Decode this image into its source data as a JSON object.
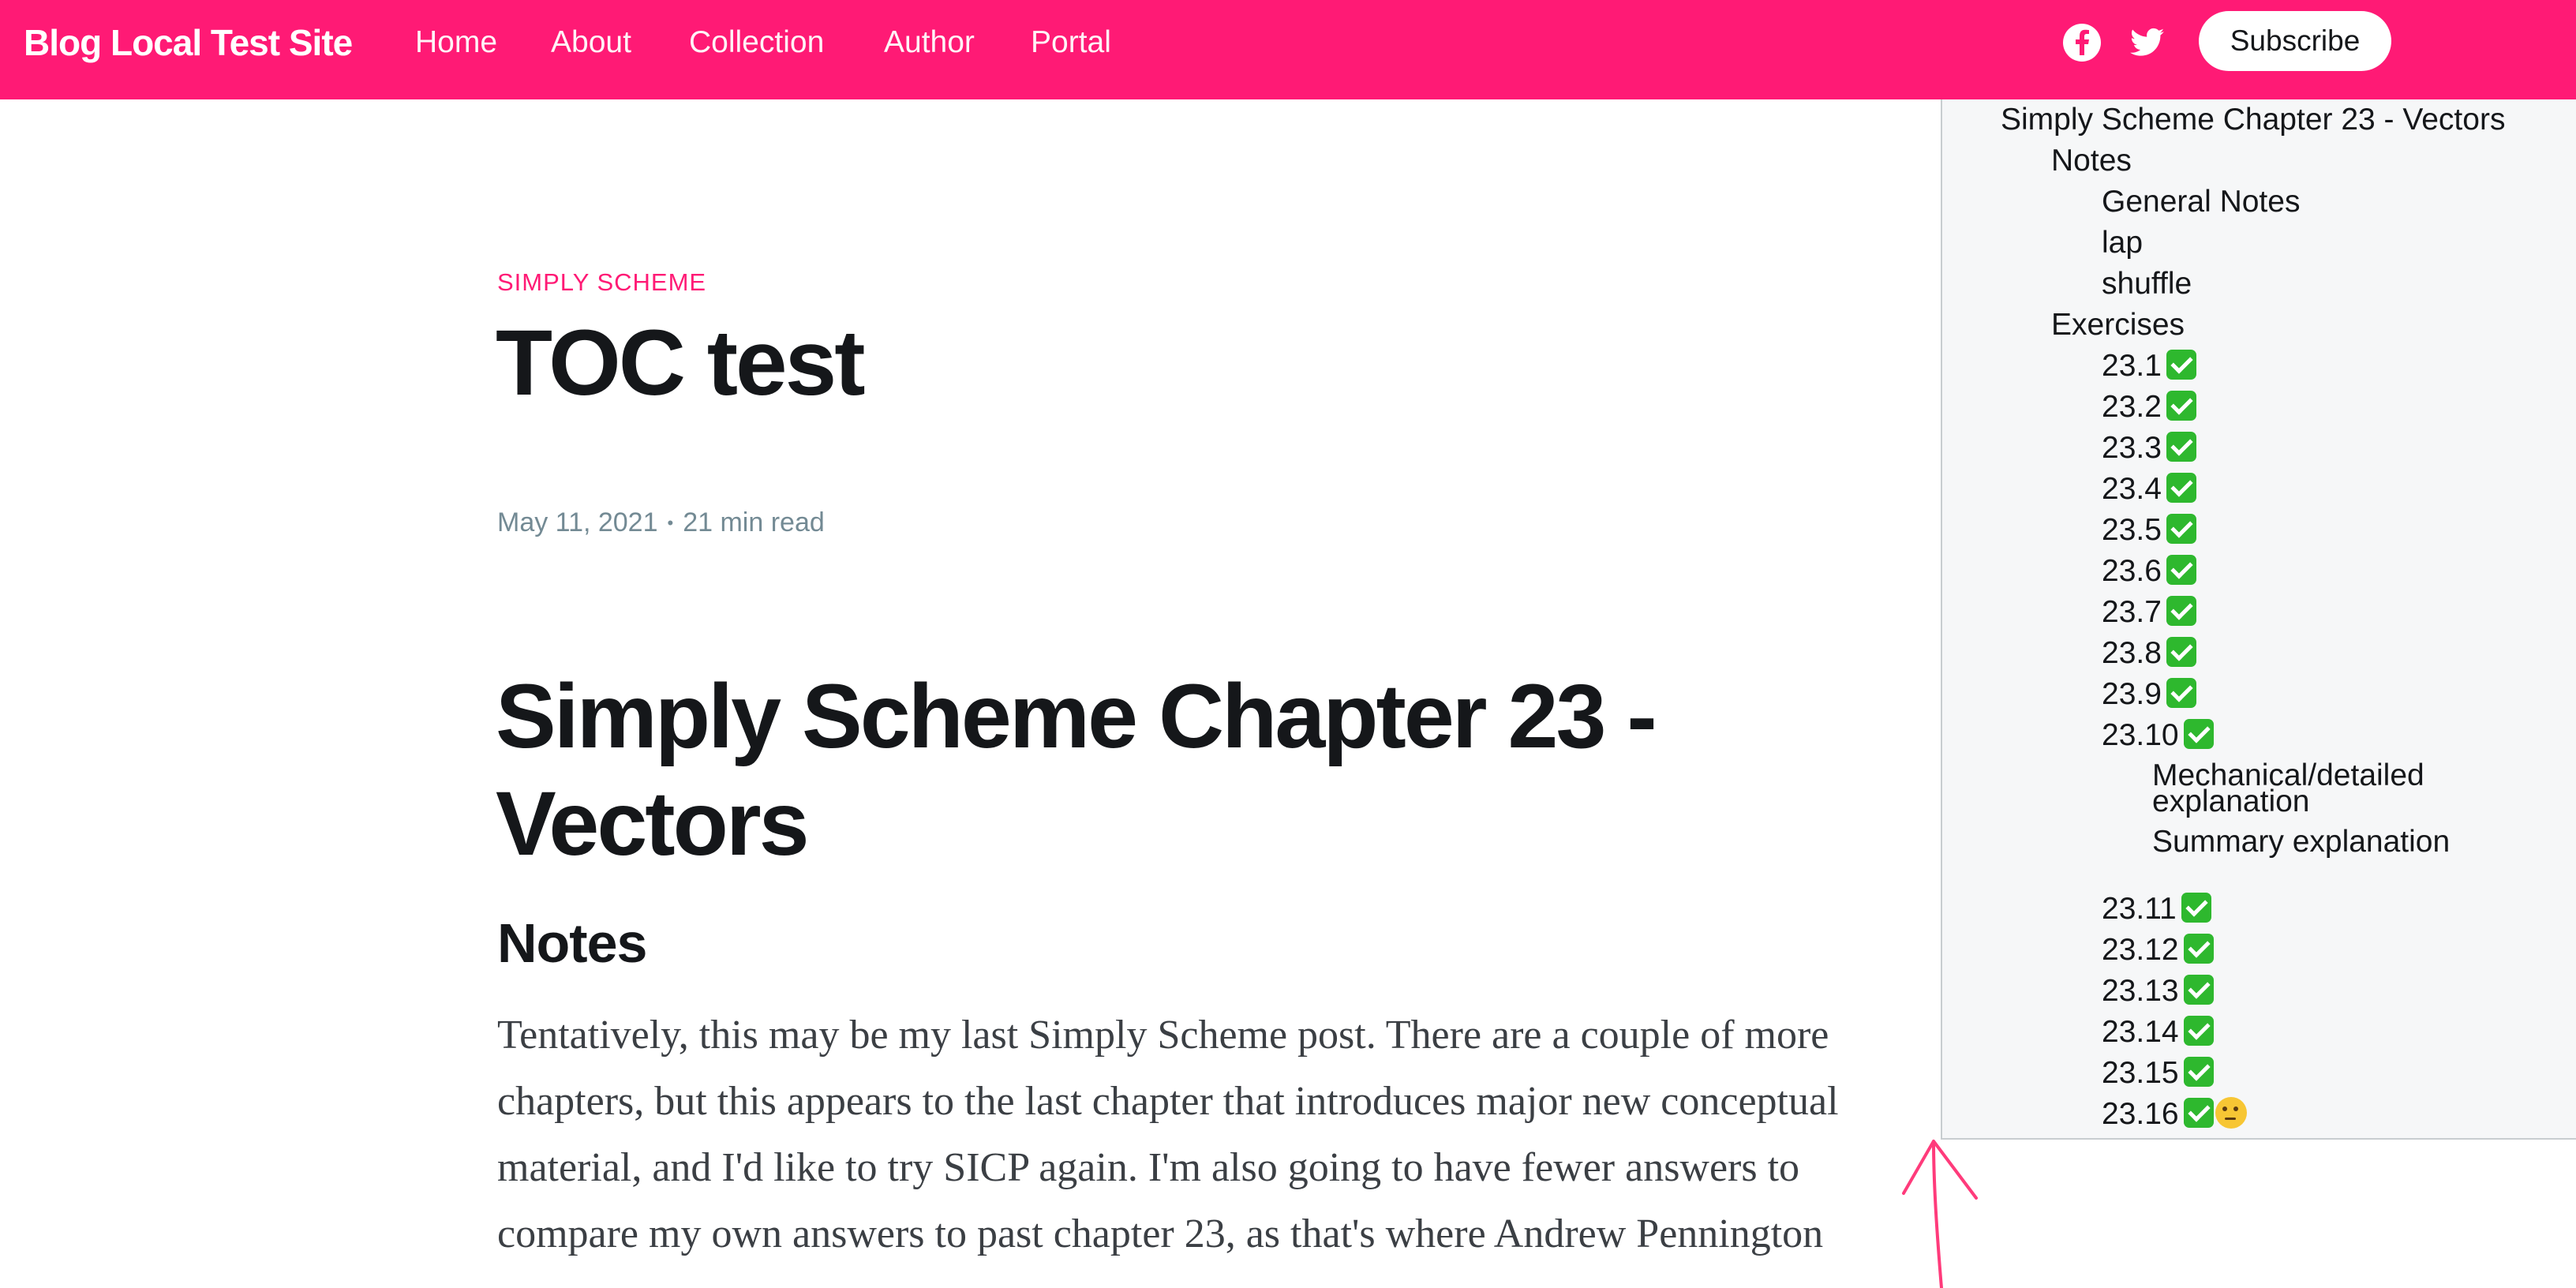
{
  "nav": {
    "site_title": "Blog Local Test Site",
    "links": [
      "Home",
      "About",
      "Collection",
      "Author",
      "Portal"
    ],
    "social": [
      "facebook-icon",
      "twitter-icon"
    ],
    "subscribe_label": "Subscribe"
  },
  "post": {
    "tag": "SIMPLY SCHEME",
    "title": "TOC test",
    "date": "May 11, 2021",
    "separator": "•",
    "read_time": "21 min read",
    "h1": "Simply Scheme Chapter 23 - Vectors",
    "h2": "Notes",
    "paragraph": "Tentatively, this may be my last Simply Scheme post. There are a couple of more chapters, but this appears to the last chapter that introduces major new conceptual material, and I'd like to try SICP again. I'm also going to have fewer answers to compare my own answers to past chapter 23, as that's where Andrew Pennington"
  },
  "toc": {
    "items": [
      {
        "text": "Simply Scheme Chapter 23 - Vectors",
        "level": 1
      },
      {
        "text": "Notes",
        "level": 2
      },
      {
        "text": "General Notes",
        "level": 3
      },
      {
        "text": "lap",
        "level": 3
      },
      {
        "text": "shuffle",
        "level": 3
      },
      {
        "text": "Exercises",
        "level": 2
      },
      {
        "text": "23.1",
        "level": 3,
        "check": true
      },
      {
        "text": "23.2",
        "level": 3,
        "check": true
      },
      {
        "text": "23.3",
        "level": 3,
        "check": true
      },
      {
        "text": "23.4",
        "level": 3,
        "check": true
      },
      {
        "text": "23.5",
        "level": 3,
        "check": true
      },
      {
        "text": "23.6",
        "level": 3,
        "check": true
      },
      {
        "text": "23.7",
        "level": 3,
        "check": true
      },
      {
        "text": "23.8",
        "level": 3,
        "check": true
      },
      {
        "text": "23.9",
        "level": 3,
        "check": true
      },
      {
        "text": "23.10",
        "level": 3,
        "check": true
      },
      {
        "text": "Mechanical/detailed explanation",
        "level": 4
      },
      {
        "text": "Summary explanation",
        "level": 4
      },
      {
        "text": "23.11",
        "level": 3,
        "check": true
      },
      {
        "text": "23.12",
        "level": 3,
        "check": true
      },
      {
        "text": "23.13",
        "level": 3,
        "check": true
      },
      {
        "text": "23.14",
        "level": 3,
        "check": true
      },
      {
        "text": "23.15",
        "level": 3,
        "check": true
      },
      {
        "text": "23.16",
        "level": 3,
        "check": true,
        "think": true
      }
    ]
  },
  "colors": {
    "accent": "#ff1a75",
    "check": "#2eb82e",
    "meta": "#738a94",
    "toc_bg": "#f6f7f8"
  }
}
